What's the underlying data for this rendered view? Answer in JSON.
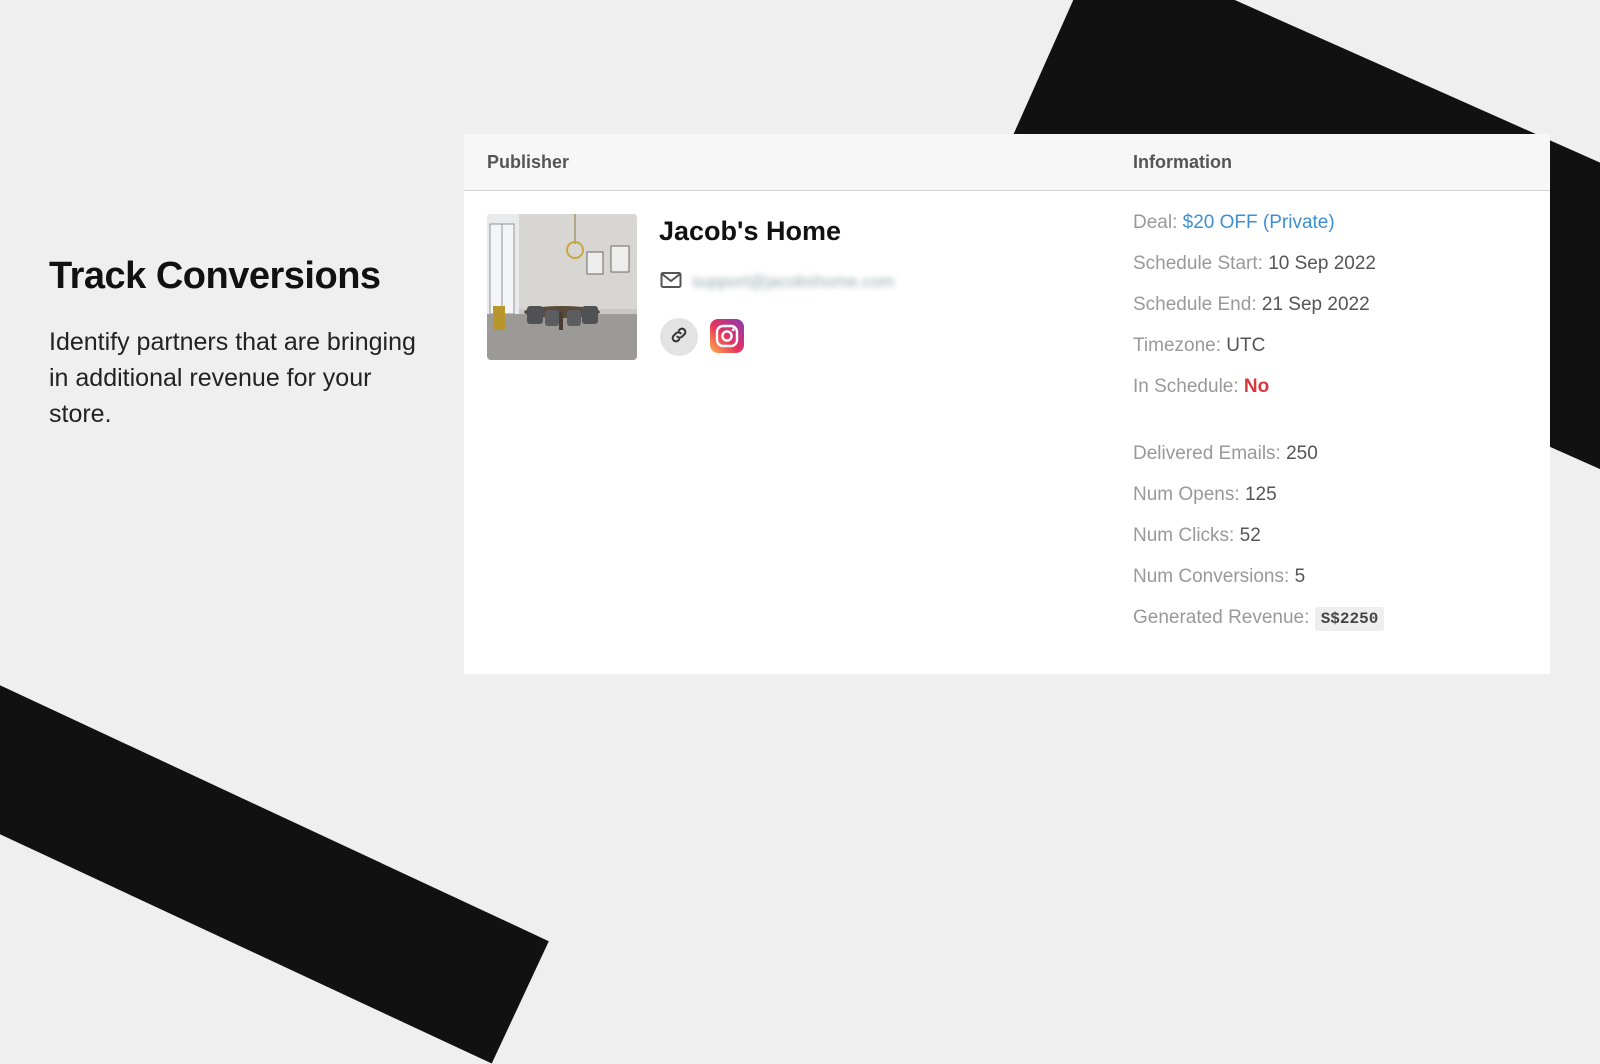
{
  "promo": {
    "title": "Track Conversions",
    "text": "Identify partners that are bringing in additional revenue for your store."
  },
  "table": {
    "headers": {
      "publisher": "Publisher",
      "information": "Information"
    },
    "publisher": {
      "name": "Jacob's Home",
      "email": "support@jacobshome.com",
      "icons": [
        "mail-icon",
        "link-icon",
        "instagram-icon"
      ]
    },
    "info": {
      "deal": {
        "label": "Deal:",
        "value": "$20 OFF (Private)"
      },
      "schedule_start": {
        "label": "Schedule Start:",
        "value": "10 Sep 2022"
      },
      "schedule_end": {
        "label": "Schedule End:",
        "value": "21 Sep 2022"
      },
      "timezone": {
        "label": "Timezone:",
        "value": "UTC"
      },
      "in_schedule": {
        "label": "In Schedule:",
        "value": "No"
      },
      "delivered_emails": {
        "label": "Delivered Emails:",
        "value": "250"
      },
      "num_opens": {
        "label": "Num Opens:",
        "value": "125"
      },
      "num_clicks": {
        "label": "Num Clicks:",
        "value": "52"
      },
      "num_conversions": {
        "label": "Num Conversions:",
        "value": "5"
      },
      "generated_revenue": {
        "label": "Generated Revenue:",
        "value": "S$2250"
      }
    }
  },
  "colors": {
    "background": "#efefef",
    "stripe": "#111111",
    "link": "#3e8fd1",
    "danger": "#d63a3a"
  }
}
